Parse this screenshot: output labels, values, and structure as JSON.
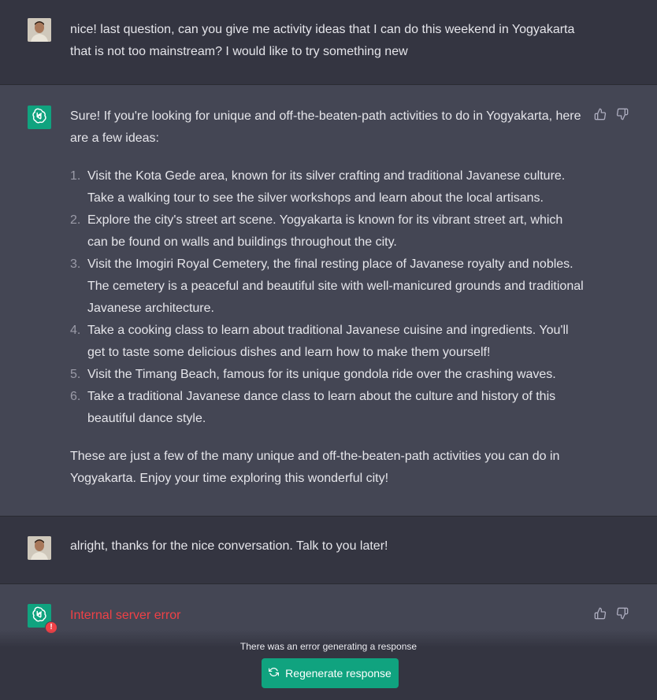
{
  "messages": {
    "user1": {
      "text": "nice! last question, can you give me activity ideas that I can do this weekend in Yogyakarta that is not too mainstream? I would like to try something new"
    },
    "assistant1": {
      "intro": "Sure! If you're looking for unique and off-the-beaten-path activities to do in Yogyakarta, here are a few ideas:",
      "ideas": [
        {
          "num": "1.",
          "text": "Visit the Kota Gede area, known for its silver crafting and traditional Javanese culture. Take a walking tour to see the silver workshops and learn about the local artisans."
        },
        {
          "num": "2.",
          "text": "Explore the city's street art scene. Yogyakarta is known for its vibrant street art, which can be found on walls and buildings throughout the city."
        },
        {
          "num": "3.",
          "text": "Visit the Imogiri Royal Cemetery, the final resting place of Javanese royalty and nobles. The cemetery is a peaceful and beautiful site with well-manicured grounds and traditional Javanese architecture."
        },
        {
          "num": "4.",
          "text": "Take a cooking class to learn about traditional Javanese cuisine and ingredients. You'll get to taste some delicious dishes and learn how to make them yourself!"
        },
        {
          "num": "5.",
          "text": "Visit the Timang Beach, famous for its unique gondola ride over the crashing waves."
        },
        {
          "num": "6.",
          "text": "Take a traditional Javanese dance class to learn about the culture and history of this beautiful dance style."
        }
      ],
      "closing": "These are just a few of the many unique and off-the-beaten-path activities you can do in Yogyakarta. Enjoy your time exploring this wonderful city!"
    },
    "user2": {
      "text": "alright, thanks for the nice conversation. Talk to you later!"
    },
    "assistant2": {
      "error": "Internal server error",
      "badge": "!"
    }
  },
  "footer": {
    "error_message": "There was an error generating a response",
    "regenerate_label": "Regenerate response"
  },
  "icons": {
    "thumbs_up": "thumbs-up-icon",
    "thumbs_down": "thumbs-down-icon",
    "openai_logo": "openai-logo-icon",
    "regenerate": "refresh-icon"
  },
  "colors": {
    "accent": "#10a37f",
    "error": "#ef4146",
    "user_bg": "#343541",
    "assistant_bg": "#444654"
  }
}
